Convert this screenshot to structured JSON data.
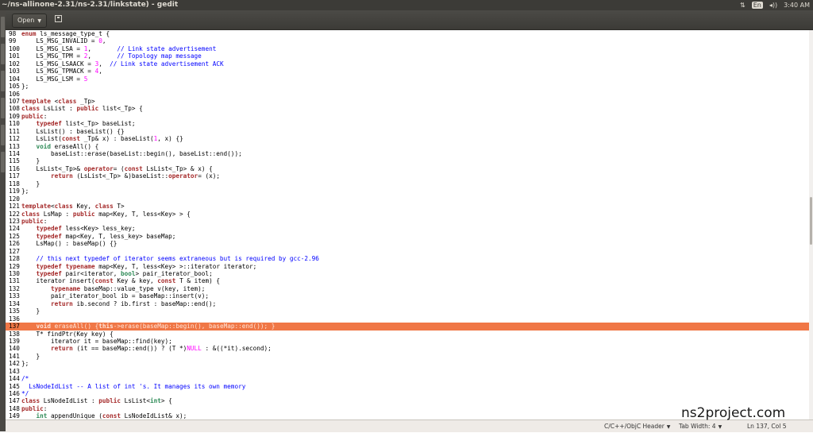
{
  "window": {
    "title": "~/ns-allinone-2.31/ns-2.31/linkstate) - gedit"
  },
  "tray": {
    "sort_icon": "sort-arrows-icon",
    "keyboard": "En",
    "volume": "◂))",
    "time": "3:40 AM"
  },
  "toolbar": {
    "open_label": "Open",
    "save_icon": "save-icon"
  },
  "code": {
    "lines": [
      {
        "n": "98",
        "html": "<span class='kw'>enum</span> ls_message_type_t {"
      },
      {
        "n": "99",
        "html": "    LS_MSG_INVALID = <span class='num'>0</span>,"
      },
      {
        "n": "100",
        "html": "    LS_MSG_LSA = <span class='num'>1</span>,       <span class='cm'>// Link state advertisement</span>"
      },
      {
        "n": "101",
        "html": "    LS_MSG_TPM = <span class='num'>2</span>,       <span class='cm'>// Topology map message</span>"
      },
      {
        "n": "102",
        "html": "    LS_MSG_LSAACK = <span class='num'>3</span>,  <span class='cm'>// Link state advertisement ACK</span>"
      },
      {
        "n": "103",
        "html": "    LS_MSG_TPMACK = <span class='num'>4</span>,"
      },
      {
        "n": "104",
        "html": "    LS_MSG_LSM = <span class='num'>5</span>"
      },
      {
        "n": "105",
        "html": "};"
      },
      {
        "n": "106",
        "html": ""
      },
      {
        "n": "107",
        "html": "<span class='kw'>template</span> &lt;<span class='kw'>class</span> _Tp&gt;"
      },
      {
        "n": "108",
        "html": "<span class='kw'>class</span> LsList : <span class='kw'>public</span> list&lt;_Tp&gt; {"
      },
      {
        "n": "109",
        "html": "<span class='kw'>public</span>:"
      },
      {
        "n": "110",
        "html": "    <span class='kw'>typedef</span> list&lt;_Tp&gt; baseList;"
      },
      {
        "n": "111",
        "html": "    LsList() : baseList() {}"
      },
      {
        "n": "112",
        "html": "    LsList(<span class='kw'>const</span> _Tp&amp; x) : baseList(<span class='num'>1</span>, x) {}"
      },
      {
        "n": "113",
        "html": "    <span class='ty'>void</span> eraseAll() {"
      },
      {
        "n": "114",
        "html": "        baseList::erase(baseList::begin(), baseList::end());"
      },
      {
        "n": "115",
        "html": "    }"
      },
      {
        "n": "116",
        "html": "    LsList&lt;_Tp&gt;&amp; <span class='kw'>operator</span>= (<span class='kw'>const</span> LsList&lt;_Tp&gt; &amp; x) {"
      },
      {
        "n": "117",
        "html": "        <span class='kw'>return</span> (LsList&lt;_Tp&gt; &amp;)baseList::<span class='kw'>operator</span>= (x);"
      },
      {
        "n": "118",
        "html": "    }"
      },
      {
        "n": "119",
        "html": "};"
      },
      {
        "n": "120",
        "html": ""
      },
      {
        "n": "121",
        "html": "<span class='kw'>template</span>&lt;<span class='kw'>class</span> Key, <span class='kw'>class</span> T&gt;"
      },
      {
        "n": "122",
        "html": "<span class='kw'>class</span> LsMap : <span class='kw'>public</span> map&lt;Key, T, less&lt;Key&gt; &gt; {"
      },
      {
        "n": "123",
        "html": "<span class='kw'>public</span>:"
      },
      {
        "n": "124",
        "html": "    <span class='kw'>typedef</span> less&lt;Key&gt; less_key;"
      },
      {
        "n": "125",
        "html": "    <span class='kw'>typedef</span> map&lt;Key, T, less_key&gt; baseMap;"
      },
      {
        "n": "126",
        "html": "    LsMap() : baseMap() {}"
      },
      {
        "n": "127",
        "html": ""
      },
      {
        "n": "128",
        "html": "    <span class='cm'>// this next typedef of iterator seems extraneous but is required by gcc-2.96</span>"
      },
      {
        "n": "129",
        "html": "    <span class='kw'>typedef</span> <span class='kw'>typename</span> map&lt;Key, T, less&lt;Key&gt; &gt;::iterator iterator;"
      },
      {
        "n": "130",
        "html": "    <span class='kw'>typedef</span> pair&lt;iterator, <span class='ty'>bool</span>&gt; pair_iterator_bool;"
      },
      {
        "n": "131",
        "html": "    iterator insert(<span class='kw'>const</span> Key &amp; key, <span class='kw'>const</span> T &amp; item) {"
      },
      {
        "n": "132",
        "html": "        <span class='kw'>typename</span> baseMap::value_type v(key, item);"
      },
      {
        "n": "133",
        "html": "        pair_iterator_bool ib = baseMap::insert(v);"
      },
      {
        "n": "134",
        "html": "        <span class='kw'>return</span> ib.second ? ib.first : baseMap::end();"
      },
      {
        "n": "135",
        "html": "    }"
      },
      {
        "n": "136",
        "html": ""
      },
      {
        "n": "137",
        "html": "    <span class='kw'>void</span> eraseAll() {<span class='kw'>this</span>-&gt;erase(baseMap::begin(), baseMap::end()); }",
        "current": true
      },
      {
        "n": "138",
        "html": "    T* findPtr(Key key) {"
      },
      {
        "n": "139",
        "html": "        iterator it = baseMap::find(key);"
      },
      {
        "n": "140",
        "html": "        <span class='kw'>return</span> (it == baseMap::end()) ? (T *)<span class='num'>NULL</span> : &amp;((*it).second);"
      },
      {
        "n": "141",
        "html": "    }"
      },
      {
        "n": "142",
        "html": "};"
      },
      {
        "n": "143",
        "html": ""
      },
      {
        "n": "144",
        "html": "<span class='cm'>/*</span>"
      },
      {
        "n": "145",
        "html": "<span class='cm'>  LsNodeIdList -- A list of int 's. It manages its own memory</span>"
      },
      {
        "n": "146",
        "html": "<span class='cm'>*/</span>"
      },
      {
        "n": "147",
        "html": "<span class='kw'>class</span> LsNodeIdList : <span class='kw'>public</span> LsList&lt;<span class='ty'>int</span>&gt; {"
      },
      {
        "n": "148",
        "html": "<span class='kw'>public</span>:"
      },
      {
        "n": "149",
        "html": "    <span class='ty'>int</span> appendUnique (<span class='kw'>const</span> LsNodeIdList&amp; x);"
      }
    ]
  },
  "statusbar": {
    "language": "C/C++/ObjC Header",
    "tab_width": "Tab Width: 4",
    "position": "Ln 137, Col 5"
  },
  "watermark": "ns2project.com"
}
